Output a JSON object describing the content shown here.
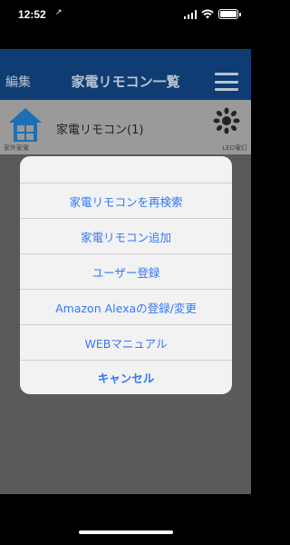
{
  "status_bar": {
    "time": "12:52",
    "location_arrow": "↗"
  },
  "nav": {
    "edit_label": "編集",
    "title": "家電リモコン一覧"
  },
  "device": {
    "name": "家電リモコン(1)",
    "left_label": "家外家電",
    "right_label": "LED電灯"
  },
  "action_sheet": {
    "items": [
      "家電リモコンを再検索",
      "家電リモコン追加",
      "ユーザー登録",
      "Amazon Alexaの登録/変更",
      "WEBマニュアル"
    ],
    "cancel_label": "キャンセル"
  },
  "colors": {
    "accent": "#3478f6",
    "nav_bar": "#0f3d73",
    "sheet_bg": "#f2f2f3"
  }
}
